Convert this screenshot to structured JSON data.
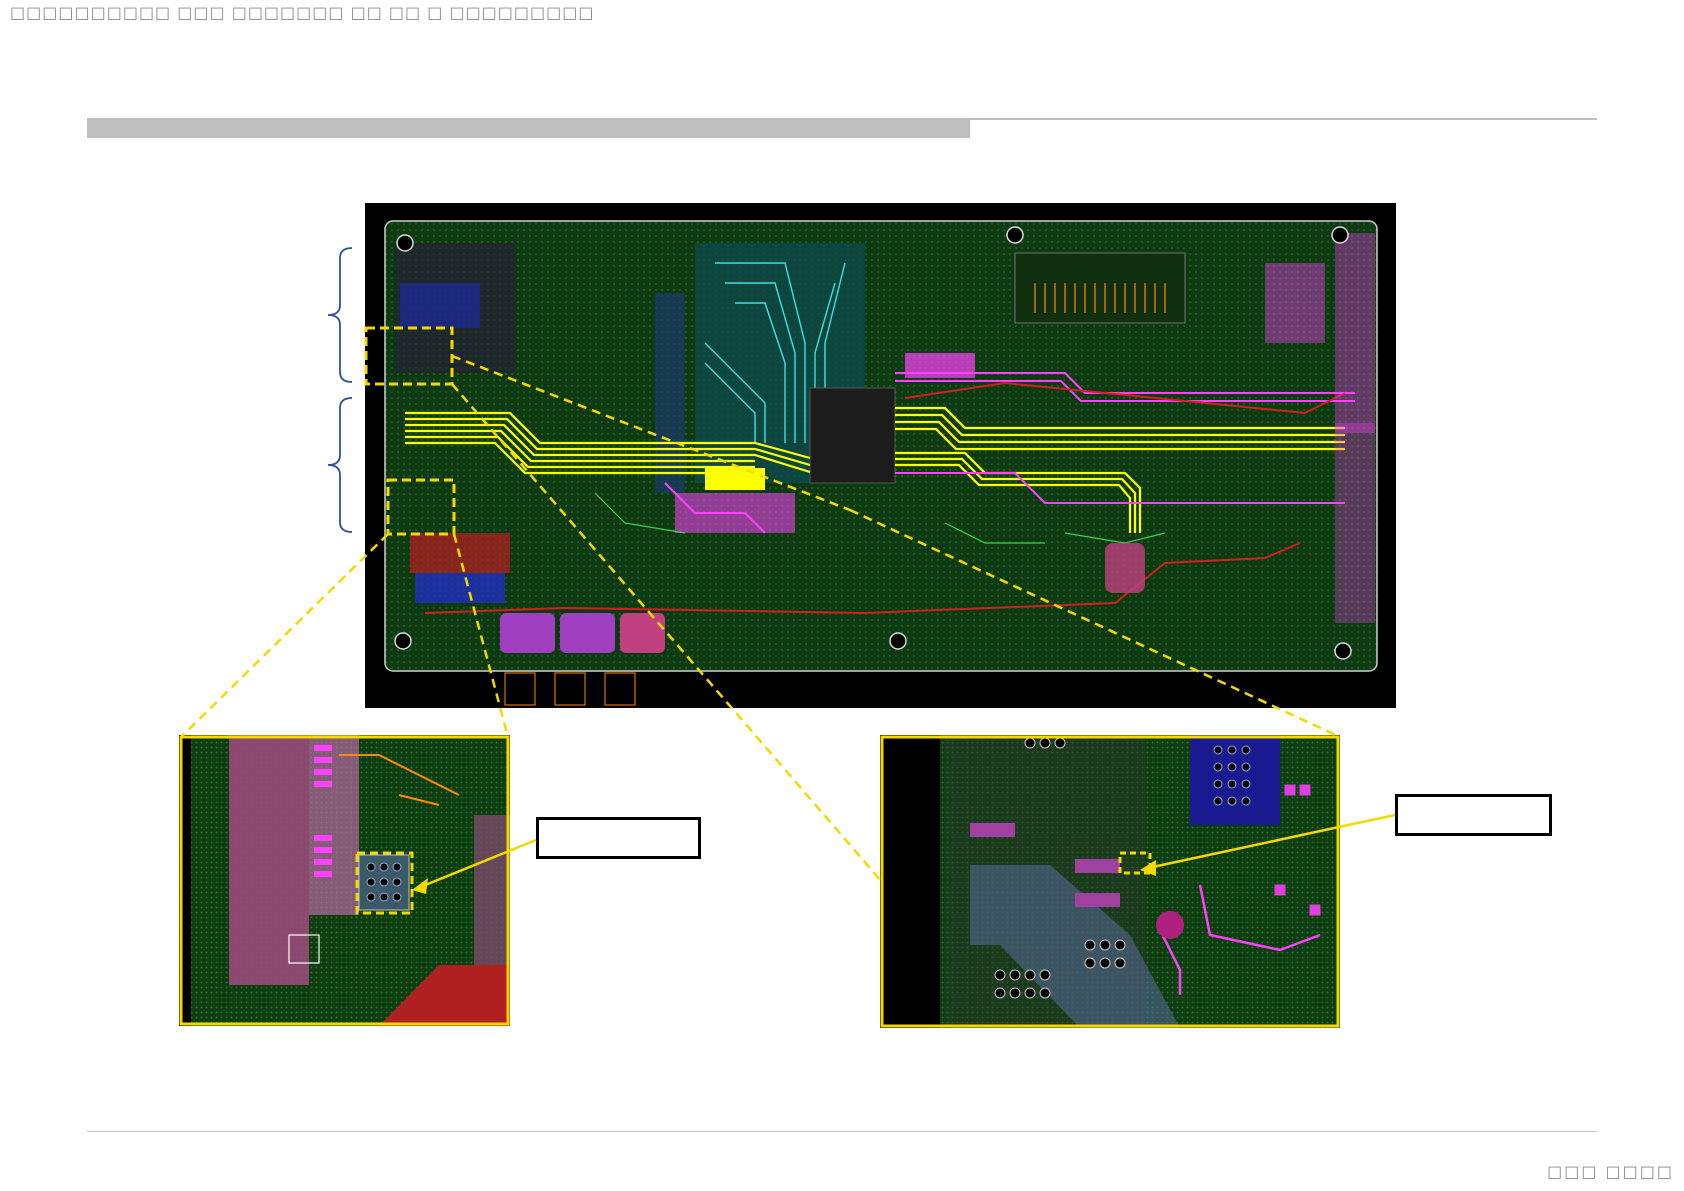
{
  "header": {
    "text": "□□□□□□□□□□ □□□ □□□□□□□ □□ □□ □ □□□□□□□□□"
  },
  "title": {
    "text": ""
  },
  "footer": {
    "page_label": "□□□ □□□□"
  },
  "callouts": {
    "left_label": "",
    "right_label": ""
  },
  "colors": {
    "highlight_yellow": "#f5d800",
    "bracket_blue": "#2f4f9c",
    "board_black": "#000000",
    "board_green": "#0d3a0f",
    "trace_yellow": "#ffff00",
    "trace_magenta": "#ff40ff",
    "trace_cyan": "#40e0e0",
    "trace_red": "#d02020",
    "trace_blue": "#2030c0"
  },
  "figure": {
    "description_icon": "pcb-layout-image"
  }
}
